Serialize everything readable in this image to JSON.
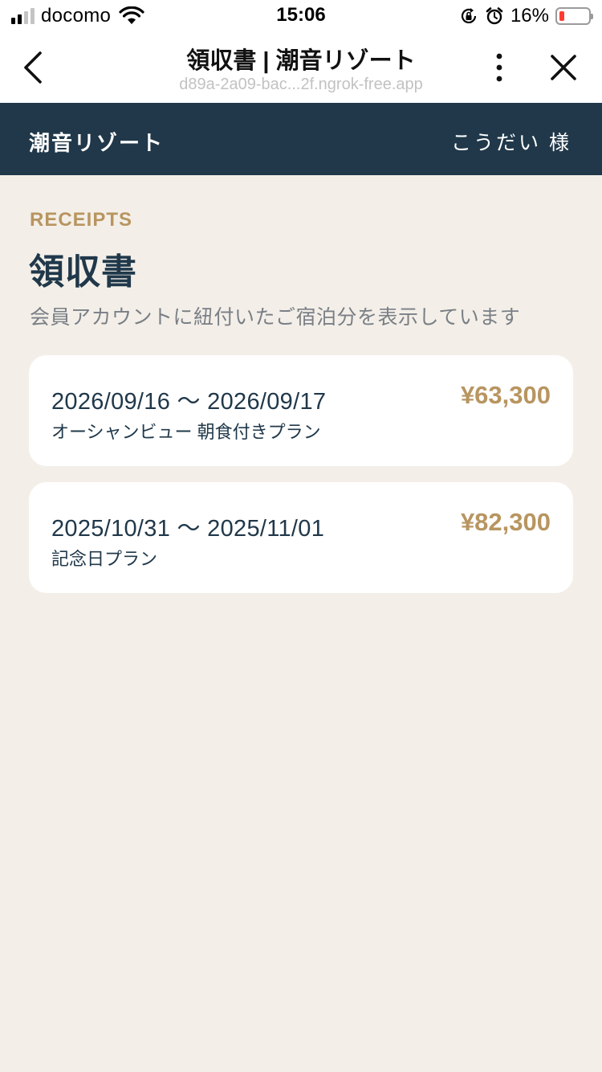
{
  "status_bar": {
    "carrier": "docomo",
    "time": "15:06",
    "battery_percent": "16%",
    "battery_level": 0.16
  },
  "browser": {
    "title": "領収書 | 潮音リゾート",
    "url": "d89a-2a09-bac...2f.ngrok-free.app"
  },
  "site_header": {
    "site_name": "潮音リゾート",
    "user_greeting": "こうだい 様"
  },
  "main": {
    "eyebrow": "RECEIPTS",
    "title": "領収書",
    "description": "会員アカウントに紐付いたご宿泊分を表示しています"
  },
  "receipts": [
    {
      "dates": "2026/09/16 〜 2026/09/17",
      "plan": "オーシャンビュー 朝食付きプラン",
      "amount": "¥63,300"
    },
    {
      "dates": "2025/10/31 〜 2025/11/01",
      "plan": "記念日プラン",
      "amount": "¥82,300"
    }
  ],
  "colors": {
    "navy": "#20384a",
    "gold": "#b89560",
    "background": "#f3efe8",
    "battery_low": "#ff3b30"
  },
  "icons": [
    "signal-icon",
    "wifi-icon",
    "orientation-lock-icon",
    "alarm-icon",
    "battery-icon",
    "back-chevron-icon",
    "more-vertical-icon",
    "close-icon"
  ]
}
